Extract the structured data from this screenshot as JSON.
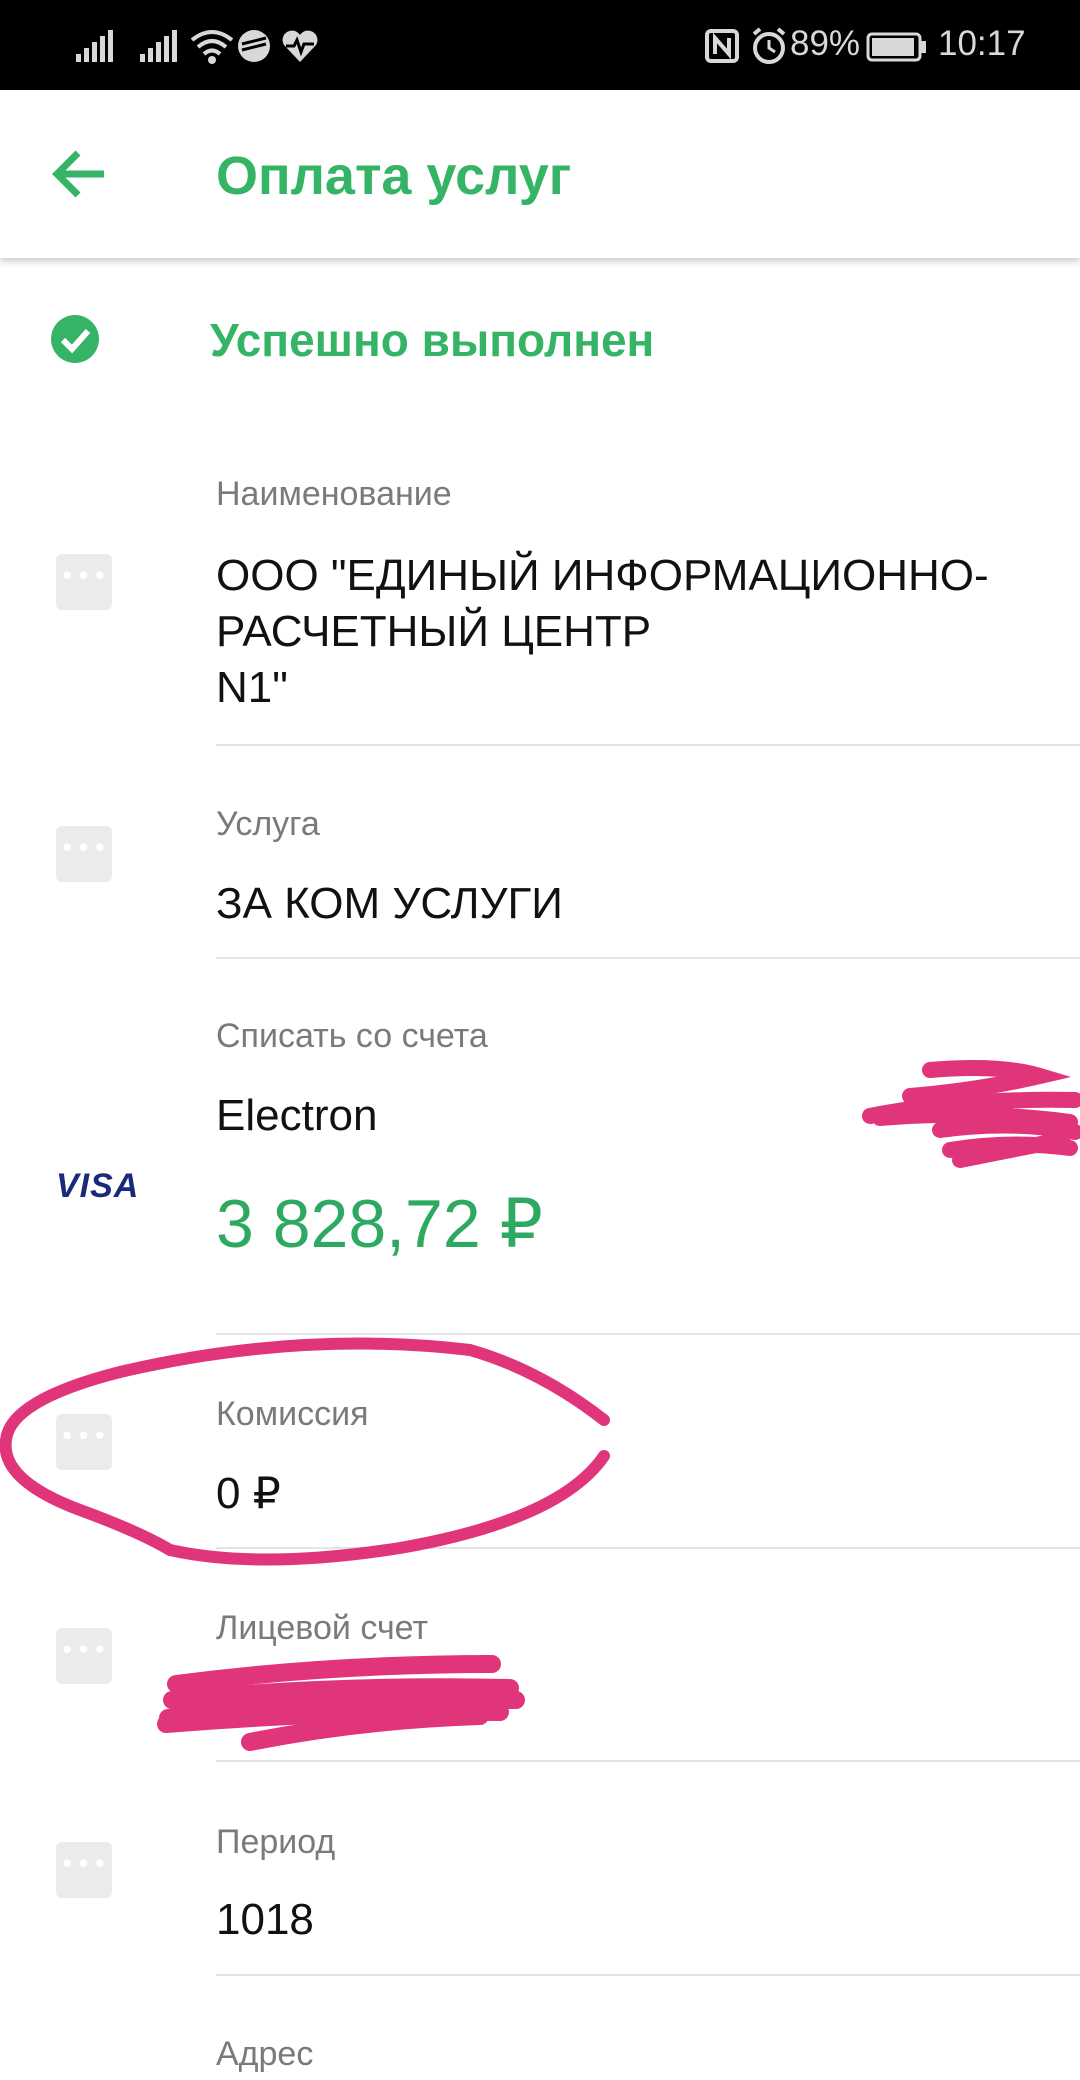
{
  "status_bar": {
    "battery": "89%",
    "time": "10:17"
  },
  "header": {
    "title": "Оплата услуг",
    "back_icon": "arrow-left-icon"
  },
  "status": {
    "text": "Успешно выполнен",
    "icon": "check-circle-icon"
  },
  "fields": {
    "name": {
      "label": "Наименование",
      "value": "ООО \"ЕДИНЫЙ ИНФОРМАЦИОННО-\nРАСЧЕТНЫЙ ЦЕНТР\nN1\""
    },
    "service": {
      "label": "Услуга",
      "value": "ЗА КОМ УСЛУГИ"
    },
    "account_from": {
      "label": "Списать со счета",
      "card": "Electron",
      "amount": "3 828,72 ₽",
      "card_brand": "VISA"
    },
    "commission": {
      "label": "Комиссия",
      "value": "0 ₽"
    },
    "personal_account": {
      "label": "Лицевой счет"
    },
    "period": {
      "label": "Период",
      "value": "1018"
    },
    "address": {
      "label": "Адрес"
    }
  },
  "colors": {
    "accent": "#36b466",
    "amount": "#2ea961",
    "annotation": "#e0357a"
  },
  "more_button_glyph": "•••"
}
